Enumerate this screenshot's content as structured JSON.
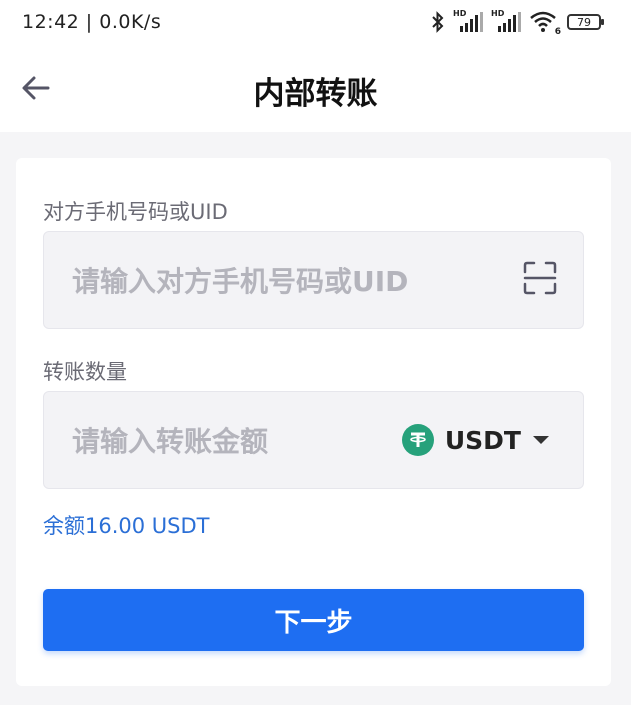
{
  "status_bar": {
    "time": "12:42 | 0.0K/s",
    "sim1_label": "HD",
    "sim2_label": "HD",
    "wifi_badge": "6",
    "battery_level": "79"
  },
  "header": {
    "title": "内部转账",
    "back_icon": "arrow-left-icon"
  },
  "form": {
    "recipient_label": "对方手机号码或UID",
    "recipient_placeholder": "请输入对方手机号码或UID",
    "recipient_value": "",
    "scan_icon": "scan-icon",
    "amount_label": "转账数量",
    "amount_placeholder": "请输入转账金额",
    "amount_value": "",
    "currency": "USDT",
    "currency_icon": "tether-icon",
    "balance_text": "余额16.00 USDT",
    "next_label": "下一步"
  },
  "colors": {
    "accent": "#1e6ef2",
    "balance_text": "#2b6fd6",
    "tether": "#26a17b",
    "page_background": "#f5f5f7"
  }
}
